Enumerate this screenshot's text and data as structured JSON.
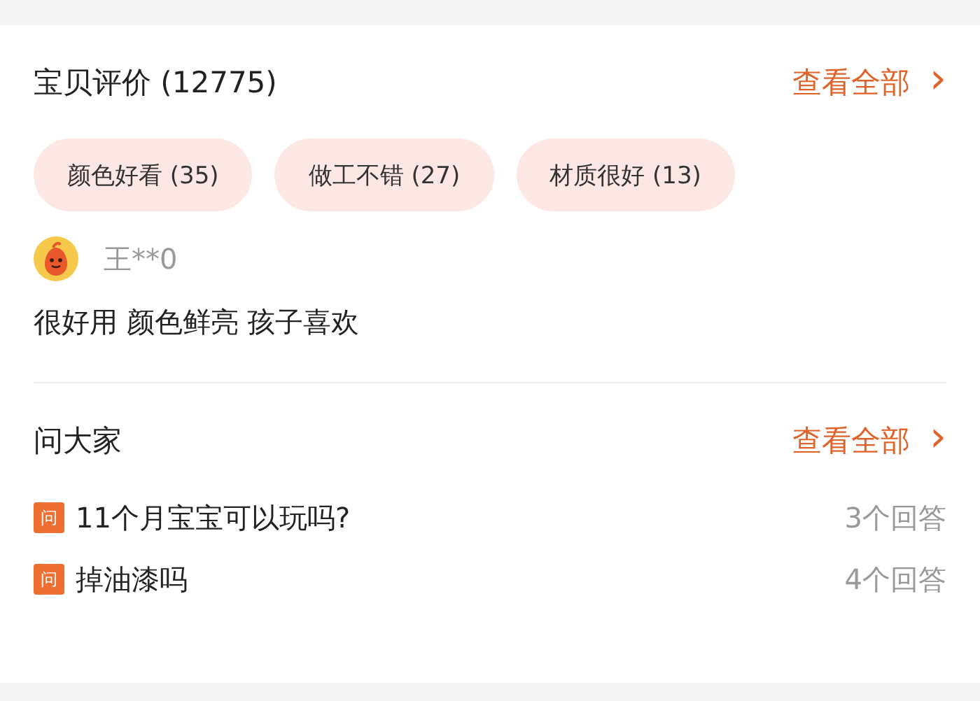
{
  "reviews": {
    "title": "宝贝评价 (12775)",
    "view_all": "查看全部",
    "chevron": "›",
    "tags": [
      {
        "label": "颜色好看 (35)"
      },
      {
        "label": "做工不错 (27)"
      },
      {
        "label": "材质很好 (13)"
      }
    ],
    "review": {
      "user": "王**0",
      "text": "很好用 颜色鲜亮 孩子喜欢"
    }
  },
  "questions": {
    "title": "问大家",
    "view_all": "查看全部",
    "chevron": "›",
    "items": [
      {
        "badge": "问",
        "question": "11个月宝宝可以玩吗?",
        "answers": "3个回答"
      },
      {
        "badge": "问",
        "question": "掉油漆吗",
        "answers": "4个回答"
      }
    ]
  }
}
